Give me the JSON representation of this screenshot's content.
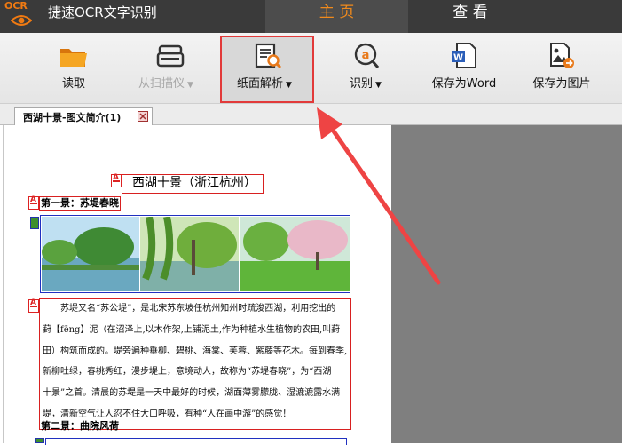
{
  "app": {
    "logo_text": "OCR",
    "title": "捷速OCR文字识别"
  },
  "tabs": {
    "main": "主 页",
    "view": "查 看"
  },
  "toolbar": {
    "read": "读取",
    "scanner": "从扫描仪",
    "paper_parse": "纸面解析",
    "recognize": "识别",
    "save_word": "保存为Word",
    "save_image": "保存为图片",
    "dropdown_glyph": "▼"
  },
  "doc_tab": {
    "label": "西湖十景-图文简介(1)"
  },
  "document": {
    "title": "西湖十景（浙江杭州）",
    "heading1": "第一景：苏堤春晓",
    "paragraph_lines": [
      "苏堤又名“苏公堤”，是北宋苏东坡任杭州知州时疏浚西湖，利用挖出的",
      "葑【fēng】泥（在沼泽上,以木作架,上铺泥土,作为种植水生植物的农田,叫葑",
      "田）构筑而成的。堤旁遍种垂柳、碧桃、海棠、芙蓉、紫藤等花木。每到春季,",
      "新柳吐绿，春桃秀红，漫步堤上，意境动人，故称为“苏堤春晓”，为“西湖",
      "十景”之首。清晨的苏堤是一天中最好的时候，湖面薄雾朦胧、湿漉漉露水满",
      "堤，清新空气让人忍不住大口呼吸，有种“人在画中游”的感觉！"
    ],
    "heading2": "第二景：曲院风荷"
  },
  "colors": {
    "accent": "#f08a1c",
    "highlight_border": "#e23a3a",
    "annotation_arrow": "#ee4444",
    "region_red": "#d82020",
    "region_blue": "#2030c0"
  }
}
